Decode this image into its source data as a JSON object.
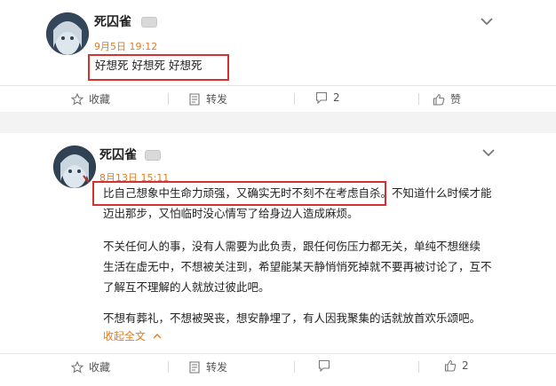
{
  "posts": [
    {
      "username": "死囚雀",
      "timestamp": "9月5日 19:12",
      "text": "好想死 好想死 好想死",
      "actions": {
        "favorite": "收藏",
        "repost": "转发",
        "comments": "2",
        "likes": "赞"
      }
    },
    {
      "username": "死囚雀",
      "timestamp": "8月13日 15:11",
      "paragraphs": [
        [
          "比自己想象中生命力顽强，又确实无时不刻不在考虑自杀。不知道什么时候才能",
          "迈出那步，又怕临时没心情写了给身边人造成麻烦。"
        ],
        [
          "不关任何人的事，没有人需要为此负责，跟任何伤压力都无关，单纯不想继续",
          "生活在虚无中，不想被关注到，希望能某天静悄悄死掉就不要再被讨论了，互不",
          "了解互不理解的人就放过彼此吧。"
        ],
        [
          "不想有葬礼，不想被哭丧，想安静埋了，有人因我聚集的话就放首欢乐颂吧。"
        ]
      ],
      "collapse_label": "收起全文",
      "actions": {
        "favorite": "收藏",
        "repost": "转发",
        "comments": "",
        "likes": "2"
      }
    }
  ],
  "colors": {
    "highlight_box": "#d8302c",
    "timestamp": "#e67a1c",
    "collapse": "#eb7a16"
  },
  "icons": [
    "avatar",
    "vip-badge",
    "chevron-down-icon",
    "star-icon",
    "repost-icon",
    "comment-icon",
    "thumbs-up-icon"
  ]
}
